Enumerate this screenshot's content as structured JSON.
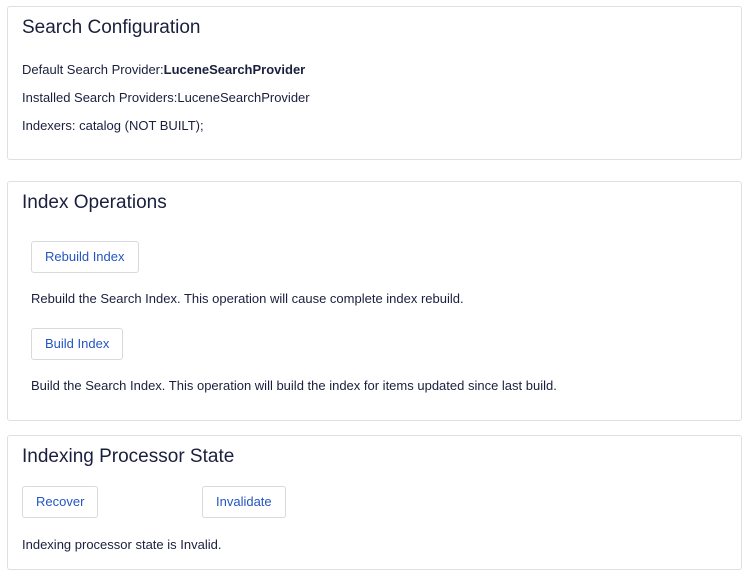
{
  "search_configuration": {
    "title": "Search Configuration",
    "default_provider_label": "Default Search Provider:",
    "default_provider_value": "LuceneSearchProvider",
    "installed_providers_label": "Installed Search Providers:",
    "installed_providers_value": "LuceneSearchProvider",
    "indexers_text": "Indexers: catalog (NOT BUILT);"
  },
  "index_operations": {
    "title": "Index Operations",
    "rebuild_button": "Rebuild Index",
    "rebuild_description": "Rebuild the Search Index. This operation will cause complete index rebuild.",
    "build_button": "Build Index",
    "build_description": "Build the Search Index. This operation will build the index for items updated since last build."
  },
  "indexing_processor_state": {
    "title": "Indexing Processor State",
    "recover_button": "Recover",
    "invalidate_button": "Invalidate",
    "state_text": "Indexing processor state is Invalid."
  },
  "colors": {
    "button_text": "#2455c3",
    "body_text": "#1a1f3d",
    "panel_border": "#dcdfe4"
  }
}
